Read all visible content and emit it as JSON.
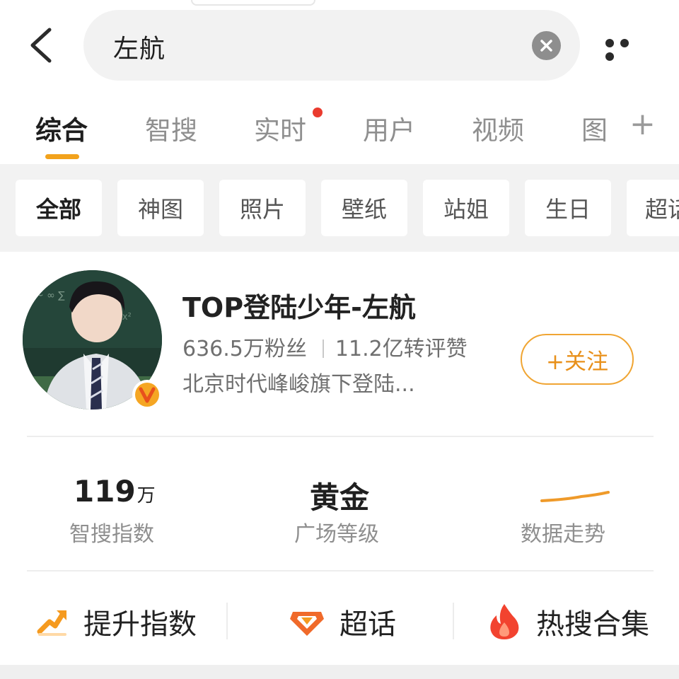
{
  "search": {
    "query": "左航"
  },
  "tabs": [
    {
      "label": "综合",
      "active": true
    },
    {
      "label": "智搜"
    },
    {
      "label": "实时",
      "dot": true
    },
    {
      "label": "用户"
    },
    {
      "label": "视频"
    },
    {
      "label": "图"
    }
  ],
  "filters": [
    {
      "label": "全部",
      "active": true
    },
    {
      "label": "神图"
    },
    {
      "label": "照片"
    },
    {
      "label": "壁纸"
    },
    {
      "label": "站姐"
    },
    {
      "label": "生日"
    },
    {
      "label": "超话"
    }
  ],
  "profile": {
    "name": "TOP登陆少年-左航",
    "followers": "636.5万粉丝",
    "engagement": "11.2亿转评赞",
    "description": "北京时代峰峻旗下登陆...",
    "follow_label": "+关注"
  },
  "metrics": {
    "search_index": {
      "value": "119",
      "unit": "万",
      "label": "智搜指数"
    },
    "plaza_level": {
      "value": "黄金",
      "label": "广场等级"
    },
    "trend": {
      "label": "数据走势"
    }
  },
  "actions": [
    {
      "label": "提升指数",
      "icon": "boost-arrow-icon"
    },
    {
      "label": "超话",
      "icon": "diamond-icon"
    },
    {
      "label": "热搜合集",
      "icon": "fire-icon"
    }
  ],
  "colors": {
    "accent": "#f2a21c",
    "follow": "#e8901a",
    "notify_dot": "#ea3b2e",
    "verified": "#f5a623"
  }
}
